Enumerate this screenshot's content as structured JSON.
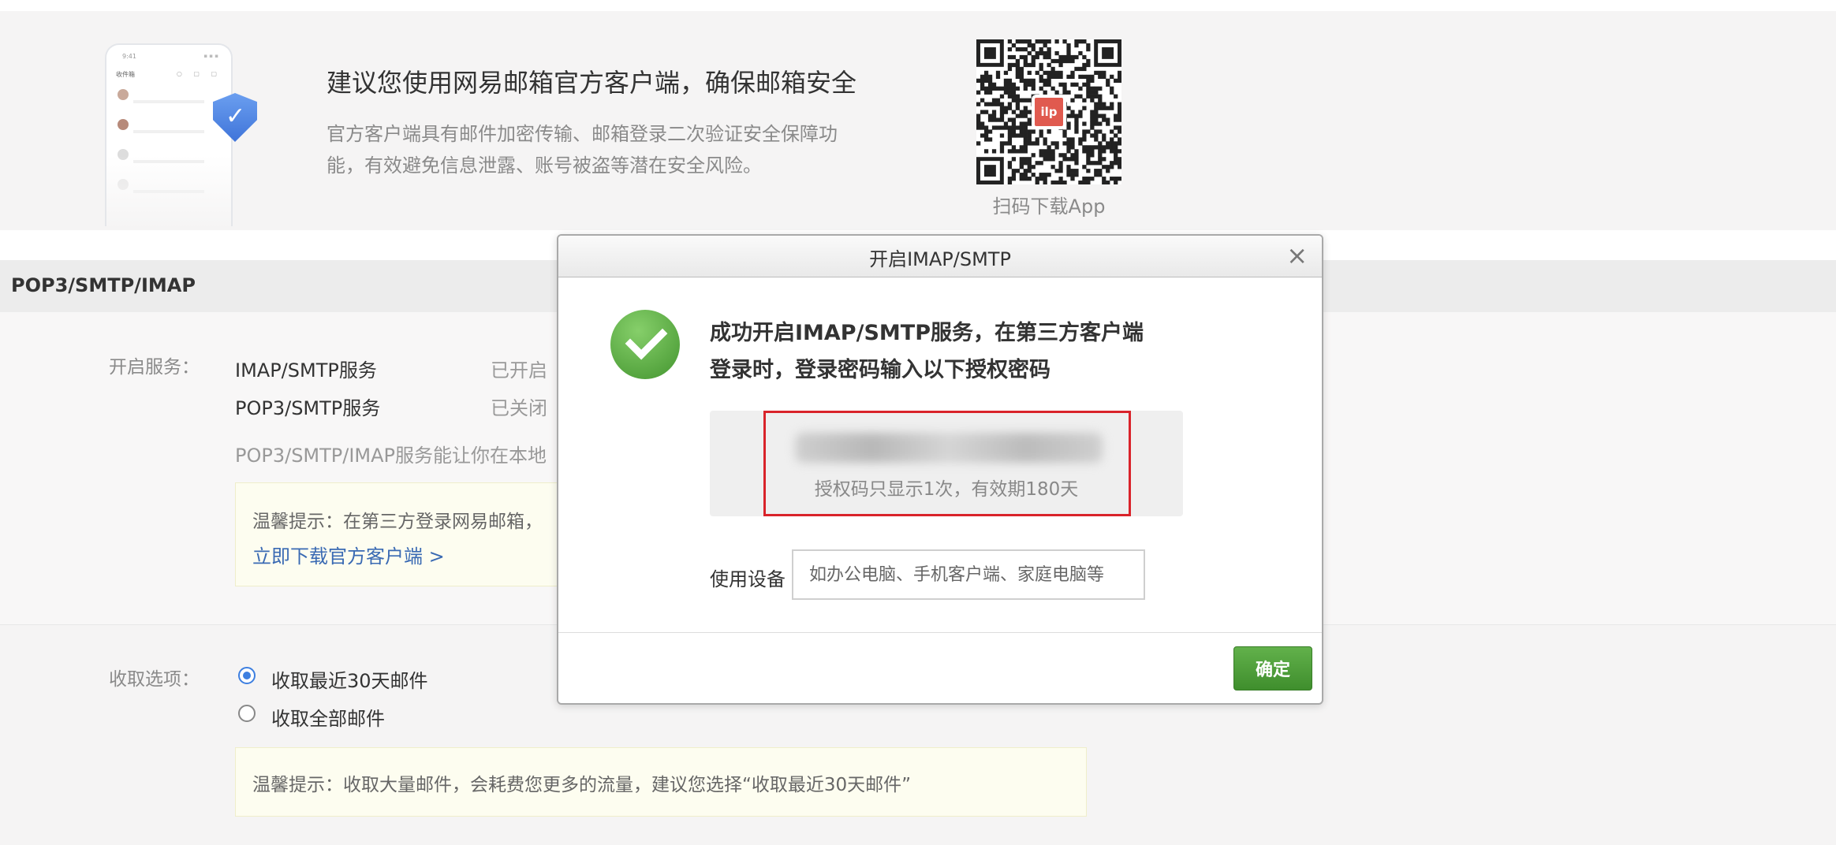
{
  "promo": {
    "title": "建议您使用网易邮箱官方客户端，确保邮箱安全",
    "desc_line1": "官方客户端具有邮件加密传输、邮箱登录二次验证安全保障功",
    "desc_line2": "能，有效避免信息泄露、账号被盗等潜在安全风险。",
    "qr_caption": "扫码下载App",
    "qr_logo": "ilp",
    "phone_time": "9:41",
    "phone_inbox": "收件箱"
  },
  "section": {
    "title": "POP3/SMTP/IMAP",
    "service_label": "开启服务：",
    "services": [
      {
        "name": "IMAP/SMTP服务",
        "state": "已开启"
      },
      {
        "name": "POP3/SMTP服务",
        "state": "已关闭"
      }
    ],
    "desc": "POP3/SMTP/IMAP服务能让你在本地",
    "tip1": "温馨提示：在第三方登录网易邮箱，",
    "download_link": "立即下载官方客户端 >",
    "receive_label": "收取选项：",
    "receive_options": [
      {
        "label": "收取最近30天邮件",
        "selected": true
      },
      {
        "label": "收取全部邮件",
        "selected": false
      }
    ],
    "tip2": "温馨提示：收取大量邮件，会耗费您更多的流量，建议您选择“收取最近30天邮件”"
  },
  "modal": {
    "title": "开启IMAP/SMTP",
    "close_icon": "×",
    "message_line1": "成功开启IMAP/SMTP服务，在第三方客户端",
    "message_line2": "登录时，登录密码输入以下授权密码",
    "code_hint": "授权码只显示1次，有效期180天",
    "device_label": "使用设备",
    "device_placeholder": "如办公电脑、手机客户端、家庭电脑等",
    "confirm_label": "确定"
  },
  "colors": {
    "accent_green": "#4a9e35",
    "highlight_red": "#d9232a",
    "link_blue": "#3a6ab3",
    "radio_blue": "#3d7fe0"
  }
}
